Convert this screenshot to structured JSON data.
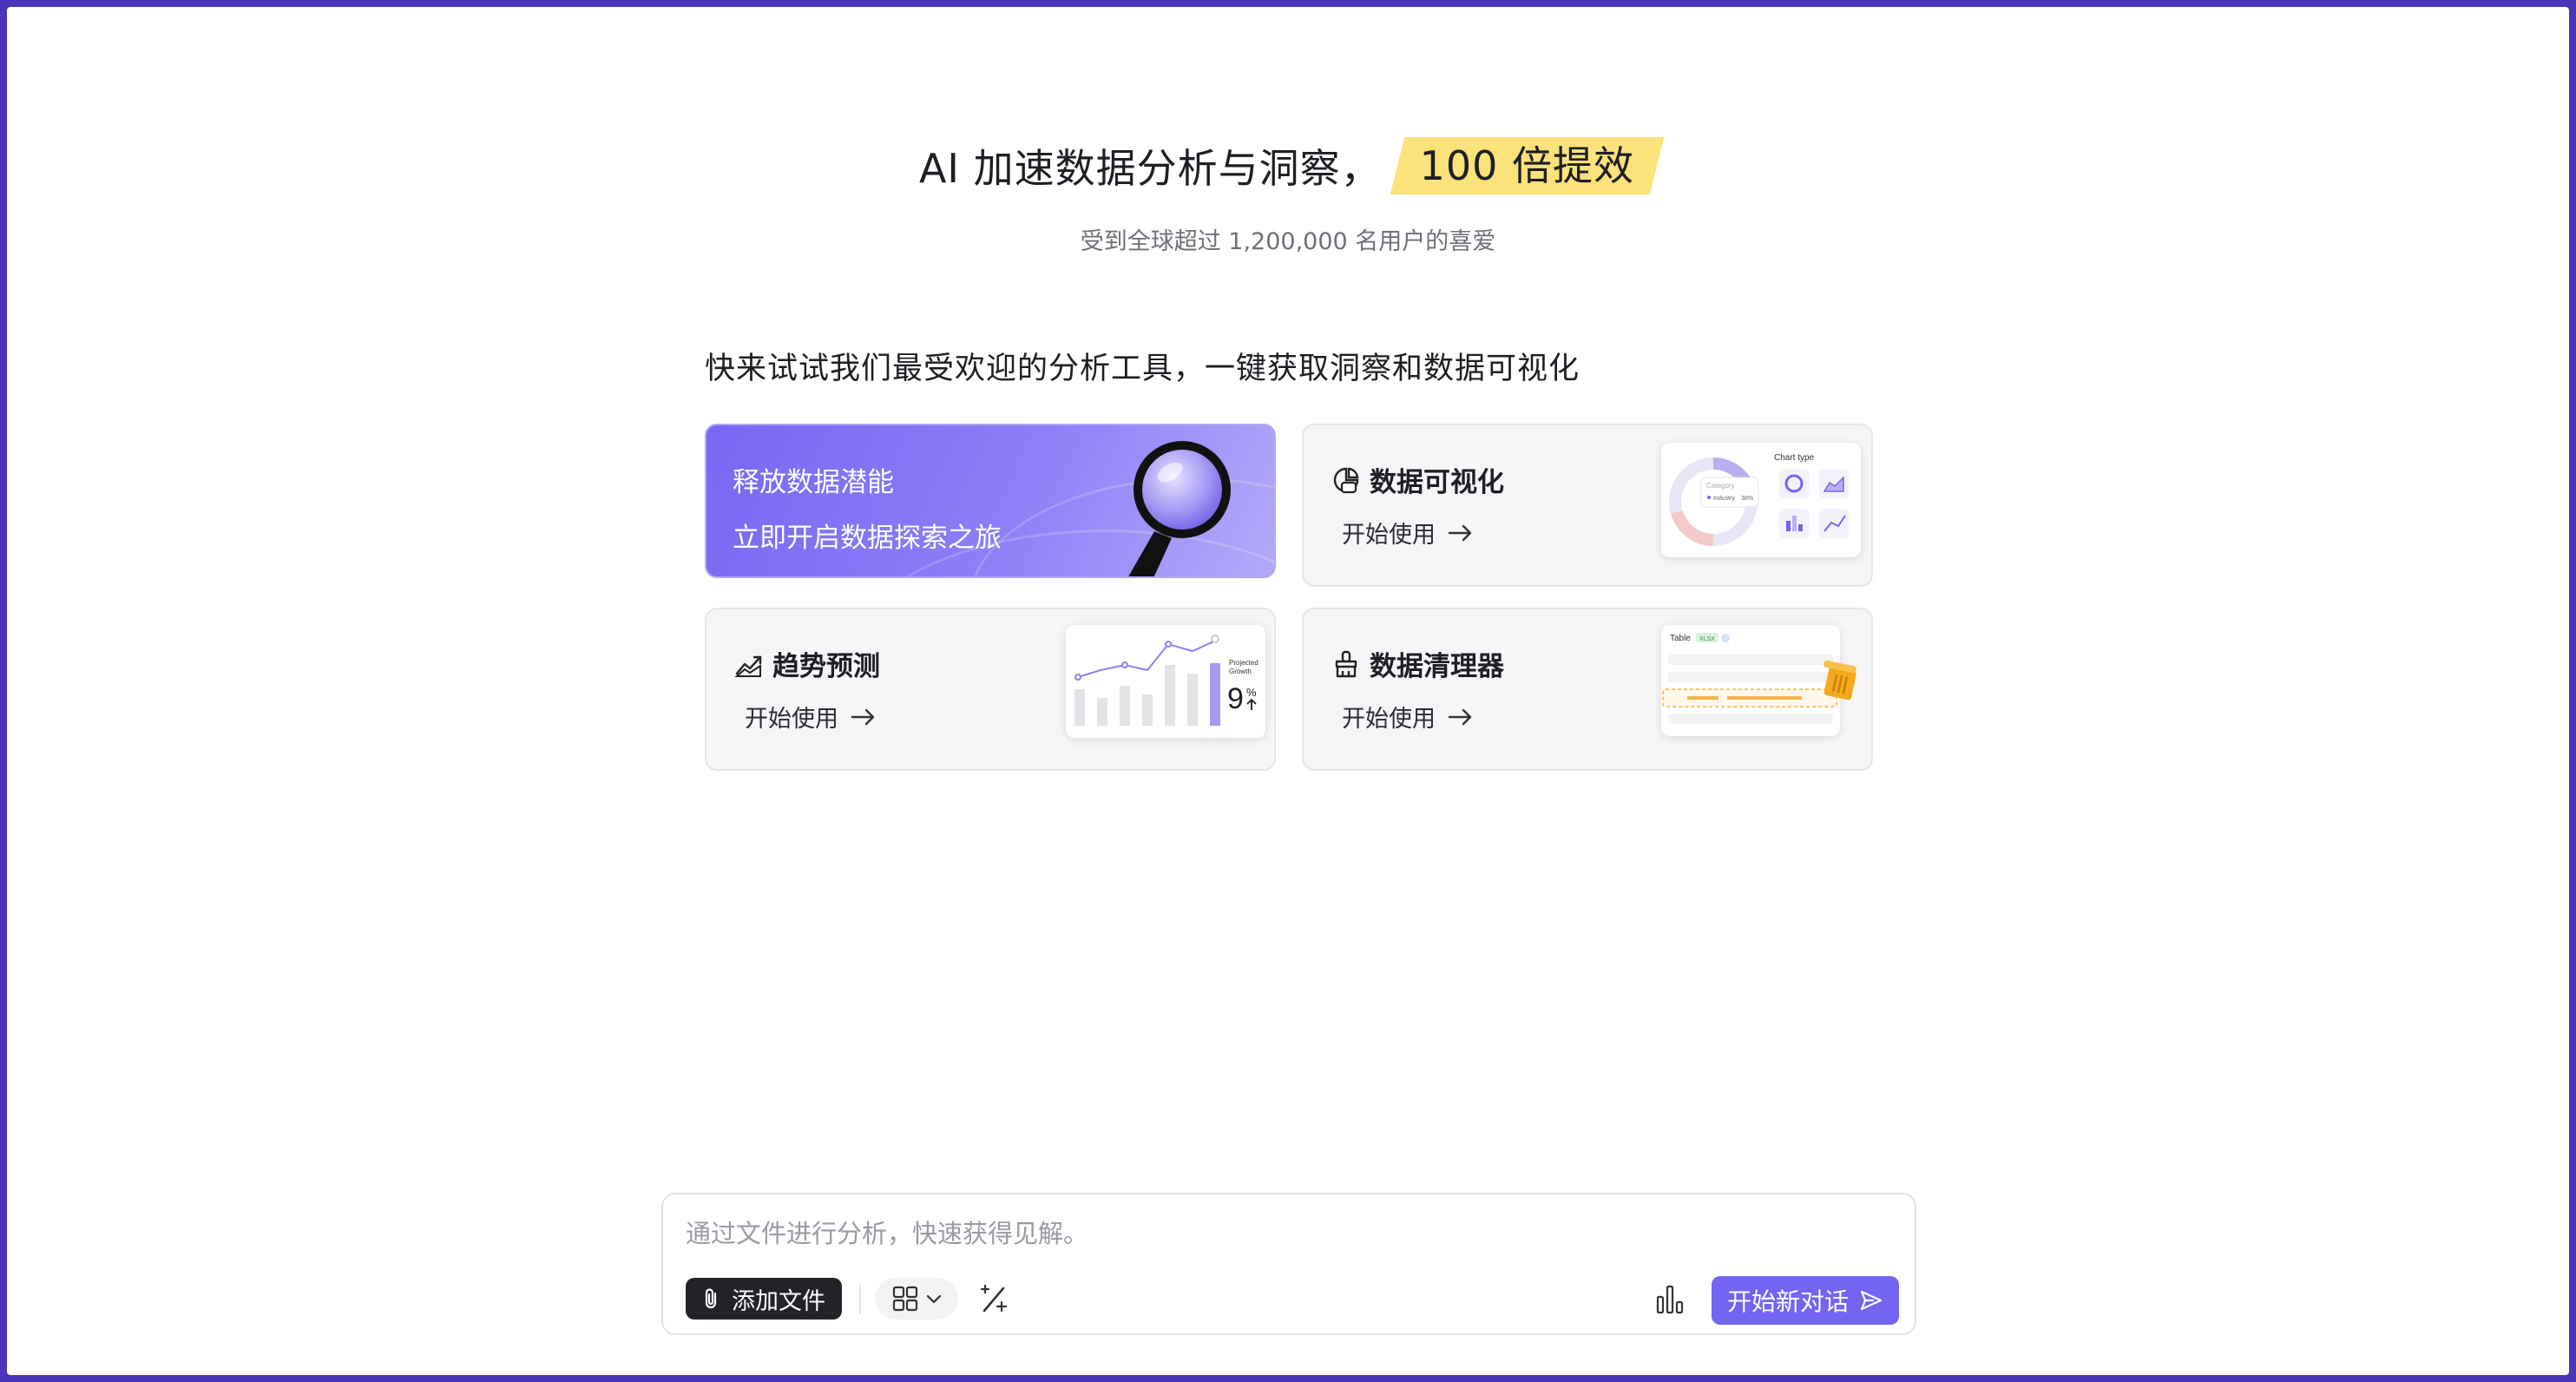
{
  "hero": {
    "title": "AI 加速数据分析与洞察，",
    "highlight": "100 倍提效",
    "subtitle": "受到全球超过 1,200,000 名用户的喜爱"
  },
  "tools_heading": "快来试试我们最受欢迎的分析工具，一键获取洞察和数据可视化",
  "promo_card": {
    "line1": "释放数据潜能",
    "line2": "立即开启数据探索之旅"
  },
  "tool_cards": [
    {
      "title": "数据可视化",
      "action": "开始使用",
      "icon": "chart-palette-icon"
    },
    {
      "title": "趋势预测",
      "action": "开始使用",
      "icon": "trend-chart-icon"
    },
    {
      "title": "数据清理器",
      "action": "开始使用",
      "icon": "broom-icon"
    }
  ],
  "previews": {
    "viz": {
      "heading": "Chart type",
      "category": "Category",
      "legend": "Industry",
      "percent": "38%"
    },
    "trend": {
      "label_line1": "Projected",
      "label_line2": "Growth",
      "value": "9",
      "unit": "%"
    },
    "clean": {
      "table_label": "Table",
      "badge": "XLSX"
    }
  },
  "composer": {
    "placeholder": "通过文件进行分析，快速获得见解。",
    "value": "",
    "add_file_label": "添加文件",
    "send_label": "开始新对话"
  },
  "colors": {
    "accent": "#7464f2",
    "highlight": "#fbe27a",
    "frame": "#4a35b8"
  }
}
